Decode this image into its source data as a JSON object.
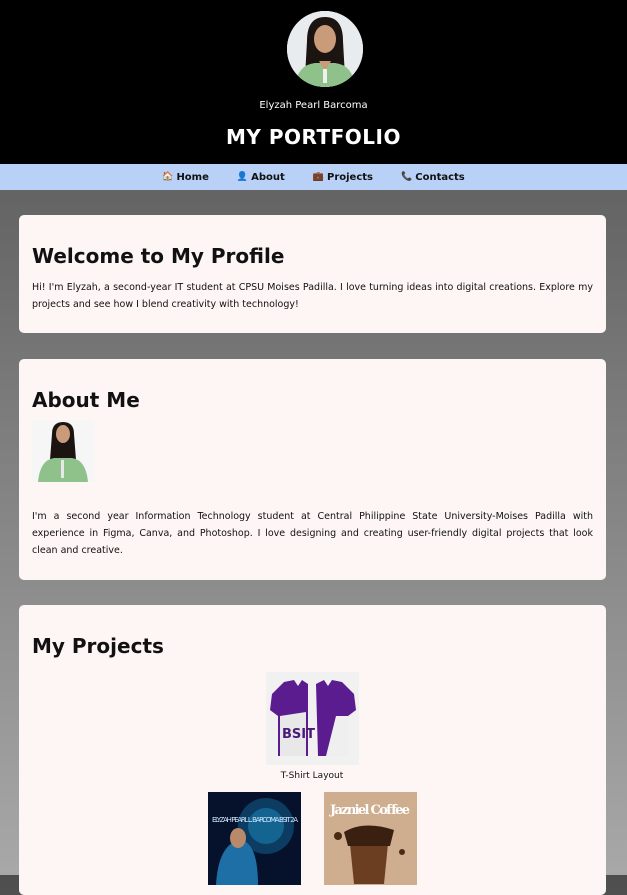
{
  "header": {
    "name": "Elyzah Pearl Barcoma",
    "title": "MY PORTFOLIO",
    "avatar_icon": "profile-photo"
  },
  "nav": {
    "items": [
      {
        "icon": "🏠",
        "label": "Home"
      },
      {
        "icon": "👤",
        "label": "About"
      },
      {
        "icon": "💼",
        "label": "Projects"
      },
      {
        "icon": "📞",
        "label": "Contacts"
      }
    ]
  },
  "welcome": {
    "heading": "Welcome to My Profile",
    "text": "Hi! I'm Elyzah, a second-year IT student at CPSU Moises Padilla. I love turning ideas into digital creations. Explore my projects and see how I blend creativity with technology!"
  },
  "about": {
    "heading": "About Me",
    "text": "I'm a second year Information Technology student at Central Philippine State University-Moises Padilla with experience in Figma, Canva, and Photoshop. I love designing and creating user-friendly digital projects that look clean and creative."
  },
  "projects": {
    "heading": "My Projects",
    "items": [
      {
        "caption": "T-Shirt Layout",
        "image_text": "BSIT"
      },
      {
        "caption": "",
        "image_text": "ELYZAH PEARL L. BARCOMA BSIT 2A"
      },
      {
        "caption": "",
        "image_text": "Jazniel Coffee"
      }
    ]
  },
  "colors": {
    "header_bg": "#000000",
    "nav_bg": "#b9d0f7",
    "card_bg": "#fdf6f5"
  }
}
